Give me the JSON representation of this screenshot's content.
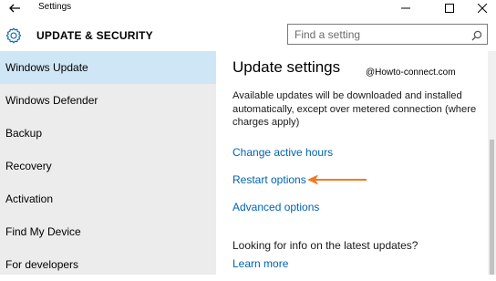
{
  "window": {
    "title": "Settings"
  },
  "header": {
    "title": "UPDATE & SECURITY",
    "search": {
      "placeholder": "Find a setting",
      "value": ""
    }
  },
  "sidebar": {
    "items": [
      {
        "label": "Windows Update",
        "active": true
      },
      {
        "label": "Windows Defender",
        "active": false
      },
      {
        "label": "Backup",
        "active": false
      },
      {
        "label": "Recovery",
        "active": false
      },
      {
        "label": "Activation",
        "active": false
      },
      {
        "label": "Find My Device",
        "active": false
      },
      {
        "label": "For developers",
        "active": false
      }
    ]
  },
  "main": {
    "title": "Update settings",
    "watermark": "@Howto-connect.com",
    "description": "Available updates will be downloaded and installed automatically, except over metered connection (where charges apply)",
    "links": {
      "change_active_hours": "Change active hours",
      "restart_options": "Restart options",
      "advanced_options": "Advanced options",
      "learn_more": "Learn more"
    },
    "info_text": "Looking for info on the latest updates?"
  },
  "colors": {
    "accent": "#0063b1",
    "active_item": "#cfe6f7",
    "sidebar_bg": "#ececec",
    "arrow": "#f07a24"
  }
}
